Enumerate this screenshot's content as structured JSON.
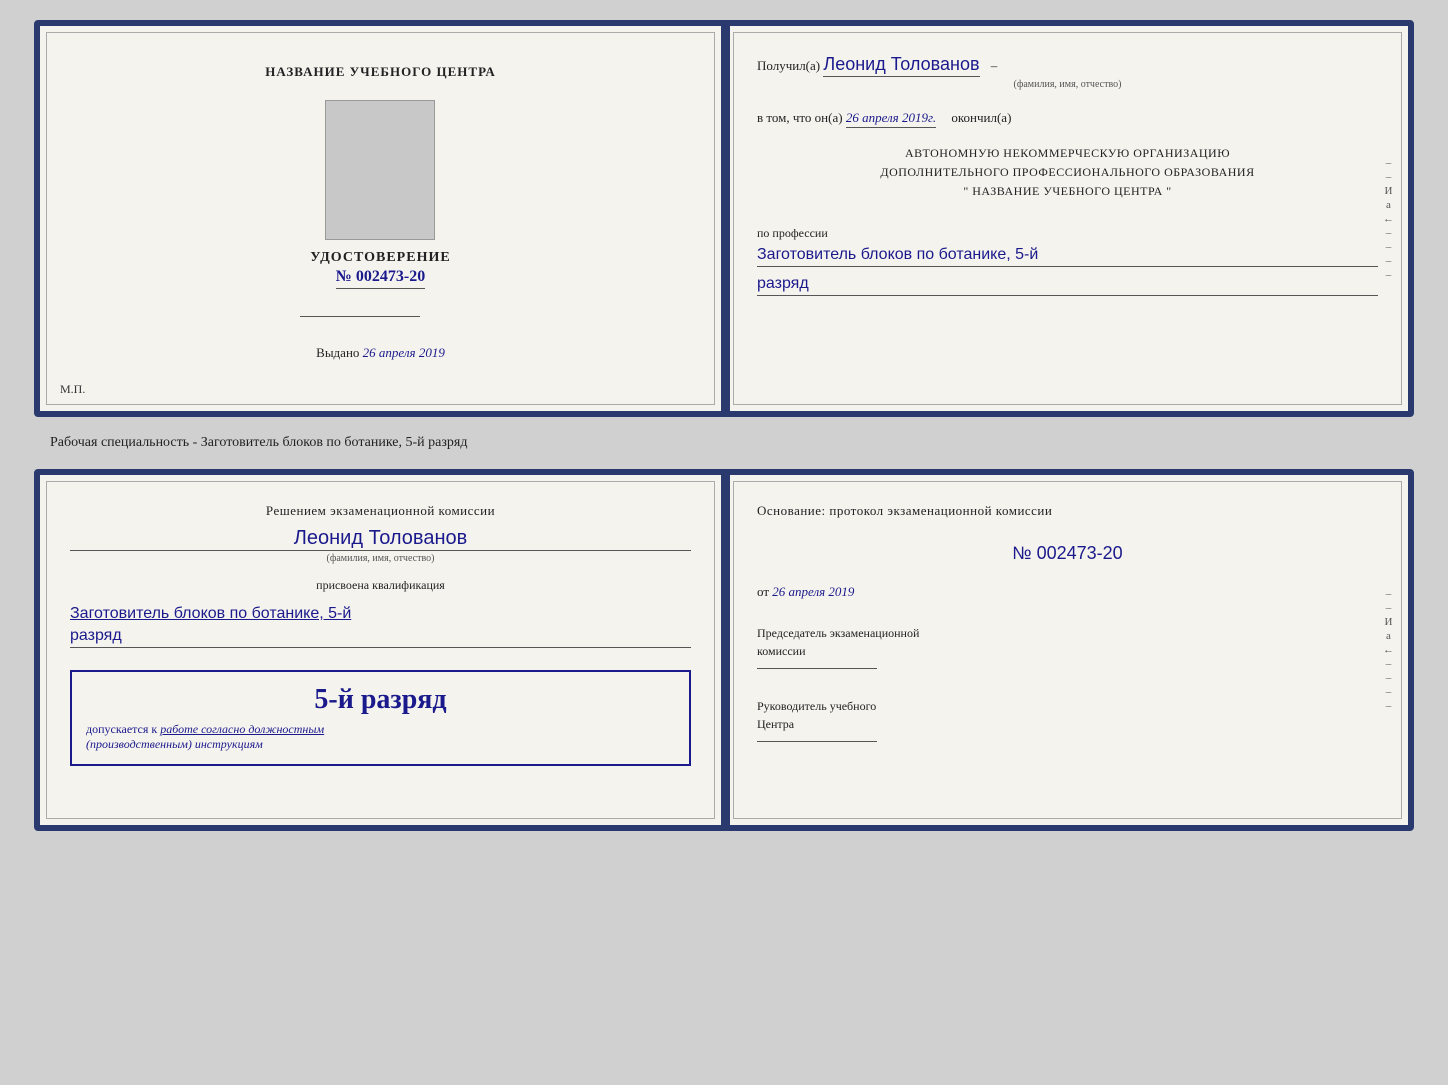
{
  "doc1": {
    "left": {
      "training_center": "НАЗВАНИЕ УЧЕБНОГО ЦЕНТРА",
      "udostoverenie_title": "УДОСТОВЕРЕНИЕ",
      "number": "№ 002473-20",
      "vydano_label": "Выдано",
      "vydano_date": "26 апреля 2019",
      "mp": "М.П."
    },
    "right": {
      "poluchil_prefix": "Получил(а)",
      "name": "Леонид Толованов",
      "fio_hint": "(фамилия, имя, отчество)",
      "dash": "–",
      "vtom_prefix": "в том, что он(а)",
      "vtom_date": "26 апреля 2019г.",
      "okonchil": "окончил(а)",
      "org_line1": "АВТОНОМНУЮ НЕКОММЕРЧЕСКУЮ ОРГАНИЗАЦИЮ",
      "org_line2": "ДОПОЛНИТЕЛЬНОГО ПРОФЕССИОНАЛЬНОГО ОБРАЗОВАНИЯ",
      "org_line3": "\"   НАЗВАНИЕ УЧЕБНОГО ЦЕНТРА   \"",
      "po_professii": "по профессии",
      "profession": "Заготовитель блоков по ботанике, 5-й",
      "razryad": "разряд"
    }
  },
  "subtitle": "Рабочая специальность - Заготовитель блоков по ботанике, 5-й разряд",
  "doc2": {
    "left": {
      "resheniem_prefix": "Решением экзаменационной комиссии",
      "name": "Леонид Толованов",
      "fio_hint": "(фамилия, имя, отчество)",
      "prisvoena": "присвоена квалификация",
      "qualification": "Заготовитель блоков по ботанике, 5-й",
      "razryad": "разряд",
      "stamp_grade": "5-й разряд",
      "dopuskaetsya": "допускается к",
      "rabote": "работе согласно должностным",
      "instruktsiyam": "(производственным) инструкциям"
    },
    "right": {
      "osnovanie": "Основание: протокол экзаменационной комиссии",
      "number": "№  002473-20",
      "ot_prefix": "от",
      "ot_date": "26 апреля 2019",
      "predsedatel_line1": "Председатель экзаменационной",
      "predsedatel_line2": "комиссии",
      "rukovoditel_line1": "Руководитель учебного",
      "rukovoditel_line2": "Центра"
    }
  },
  "margin_chars": {
    "i": "И",
    "ya": "а",
    "arrow": "←",
    "dash": "–"
  }
}
